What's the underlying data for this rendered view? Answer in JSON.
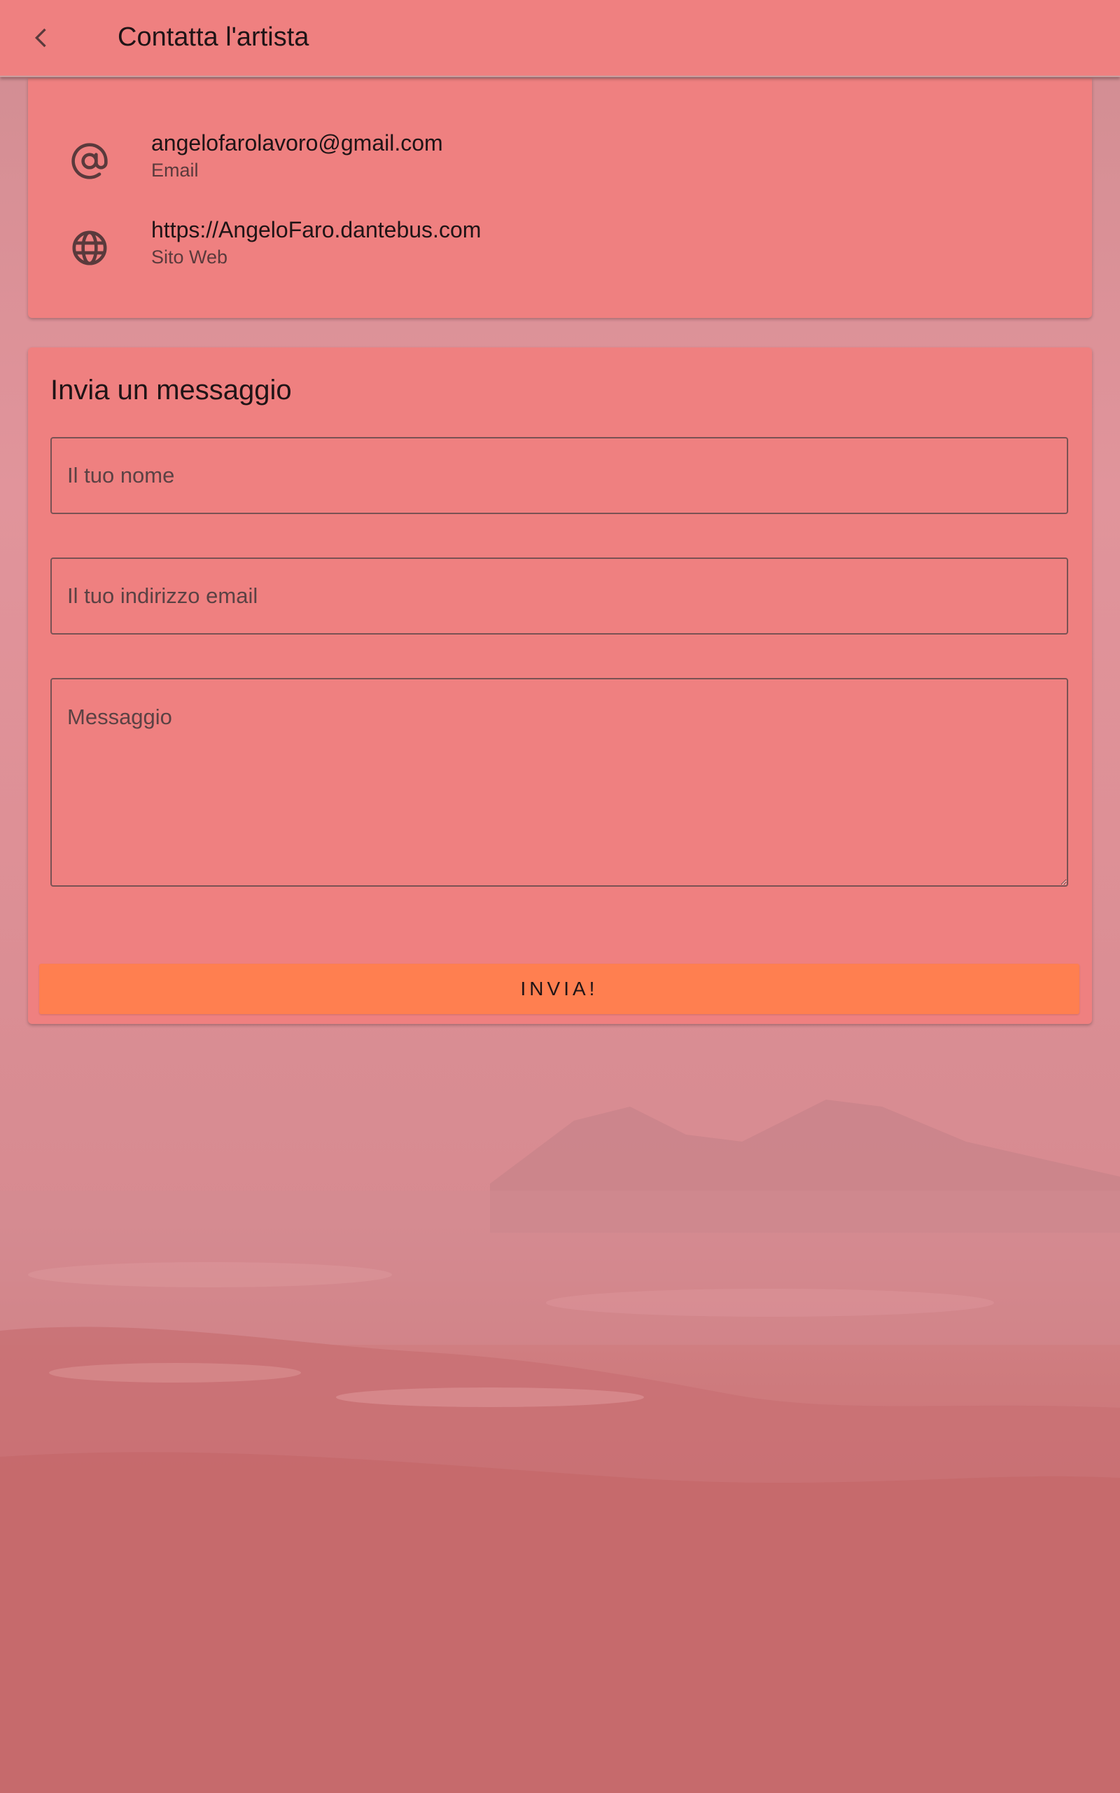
{
  "appbar": {
    "title": "Contatta l'artista",
    "back_icon": "chevron-left-icon"
  },
  "contacts": [
    {
      "icon": "at-sign-icon",
      "value": "angelofarolavoro@gmail.com",
      "label": "Email"
    },
    {
      "icon": "globe-icon",
      "value": "https://AngeloFaro.dantebus.com",
      "label": "Sito Web"
    }
  ],
  "form": {
    "title": "Invia un messaggio",
    "name_placeholder": "Il tuo nome",
    "email_placeholder": "Il tuo indirizzo email",
    "message_placeholder": "Messaggio",
    "send_label": "INVIA!"
  },
  "colors": {
    "surface": "#ef8080",
    "accent_button": "#ff7f50",
    "text_primary": "#1f1416",
    "text_secondary": "#5a3a3c"
  }
}
